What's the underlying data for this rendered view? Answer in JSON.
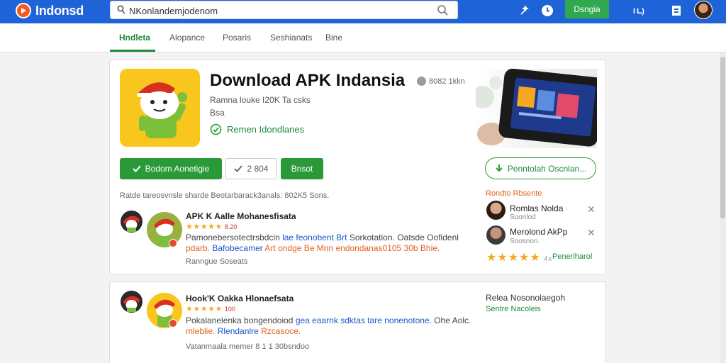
{
  "brand": {
    "name": "Indonsd",
    "logo_icon": "play-icon"
  },
  "search": {
    "value": "NKonlandemjodenom",
    "placeholder": ""
  },
  "header_icons": [
    "sparkle-icon",
    "update-icon",
    "history-icon",
    "bookmark-icon"
  ],
  "header": {
    "signin_label": "Dsngia"
  },
  "tabs": [
    {
      "label": "Hndleta",
      "active": true
    },
    {
      "label": "Alopance",
      "active": false
    },
    {
      "label": "Posaris",
      "active": false
    },
    {
      "label": "Seshianats",
      "active": false
    },
    {
      "label": "Bine",
      "active": false
    }
  ],
  "app": {
    "title": "Download APK Indansia",
    "rating_text": "8082 1kkn",
    "meta": "Ramna louke  I20K Ta csks",
    "meta2": "Bsa",
    "verified_label": "Remen Idondlanes"
  },
  "actions": {
    "download_label": "Bodom Aonetigie",
    "version_label": "2 804",
    "share_label": "Bnsot",
    "outline_label": "Penntolah Oscnlan..."
  },
  "info_line": "Ratde tareosvnsle sharde Beotarbarack3anals: 802K5 Sons.",
  "comments": [
    {
      "title": "APK K Aalle Mohanesfisata",
      "score": "8.20",
      "text_a": "Pamonebersotectrsbdcin ",
      "text_a_blue": "lae feonobent Brt",
      "text_a_tail": " Sorkotation. Oatsde Oofidenl",
      "text_b": "pdarb. ",
      "text_b_blue": "Bafobecamer",
      "text_b_orange": " Art ondge Be Mnn endondanas0105 30b Bhie.",
      "footer": "Ranngue Soseats"
    },
    {
      "title": "Hook'K Oakka Hlonaefsata",
      "score": "100",
      "text_a": "Pokalanelenka bongendoiod ",
      "text_a_blue": "gea eaarnk sdktas tare nonenotone.",
      "text_a_tail": " Ohe Aolc.",
      "text_b": "mleblie. ",
      "text_b_blue": "Rlendanlre",
      "text_b_orange": " Rzcasoce.",
      "footer": "Vatanmaala memer  8 1 1  30bsndoo"
    }
  ],
  "sidebar": {
    "heading": "Rondto Rbsente",
    "users": [
      {
        "name": "Romlas Nolda",
        "sub": "Soonlod"
      },
      {
        "name": "Merolond AkPp",
        "sub": "Soosnon."
      }
    ],
    "rating_extra": "4x",
    "link": "Peneriharol",
    "heading2": "Relea Nosonolaegoh",
    "sub2": "Sentre Nacoleis"
  },
  "colors": {
    "topbar": "#1f63d8",
    "accent_green": "#2a9937",
    "star": "#f5a623",
    "link_blue": "#1a55c8",
    "highlight_orange": "#e2621a"
  }
}
